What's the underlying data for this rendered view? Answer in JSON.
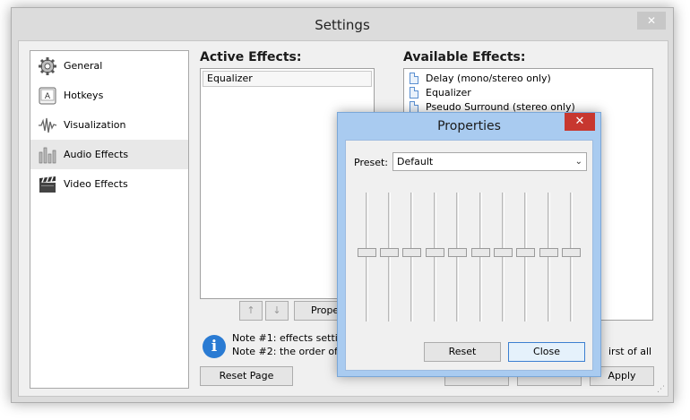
{
  "window": {
    "title": "Settings",
    "close_glyph": "✕"
  },
  "sidebar": {
    "items": [
      {
        "label": "General",
        "icon": "gear-icon",
        "selected": false
      },
      {
        "label": "Hotkeys",
        "icon": "key-icon",
        "selected": false
      },
      {
        "label": "Visualization",
        "icon": "waveform-icon",
        "selected": false
      },
      {
        "label": "Audio Effects",
        "icon": "audio-bars-icon",
        "selected": true
      },
      {
        "label": "Video Effects",
        "icon": "clapperboard-icon",
        "selected": false
      }
    ]
  },
  "active_effects": {
    "title": "Active Effects:",
    "items": [
      "Equalizer"
    ],
    "up_label": "↑",
    "down_label": "↓",
    "properties_label": "Proper"
  },
  "available_effects": {
    "title": "Available Effects:",
    "items": [
      "Delay (mono/stereo only)",
      "Equalizer",
      "Pseudo Surround (stereo only)"
    ]
  },
  "notes": {
    "note1": "Note #1: effects setting",
    "note2": "Note #2: the order of ef",
    "note2_tail": "irst of all"
  },
  "buttons": {
    "reset_page": "Reset Page",
    "apply": "Apply"
  },
  "properties_dialog": {
    "title": "Properties",
    "close_glyph": "✕",
    "preset_label": "Preset:",
    "preset_value": "Default",
    "reset_label": "Reset",
    "close_label": "Close",
    "band_levels": [
      0.5,
      0.5,
      0.5,
      0.5,
      0.5,
      0.5,
      0.5,
      0.5,
      0.5,
      0.5
    ]
  },
  "colors": {
    "accent": "#2a7bd3",
    "dialog_frame": "#a9cbf0",
    "close_red": "#c7372f"
  }
}
